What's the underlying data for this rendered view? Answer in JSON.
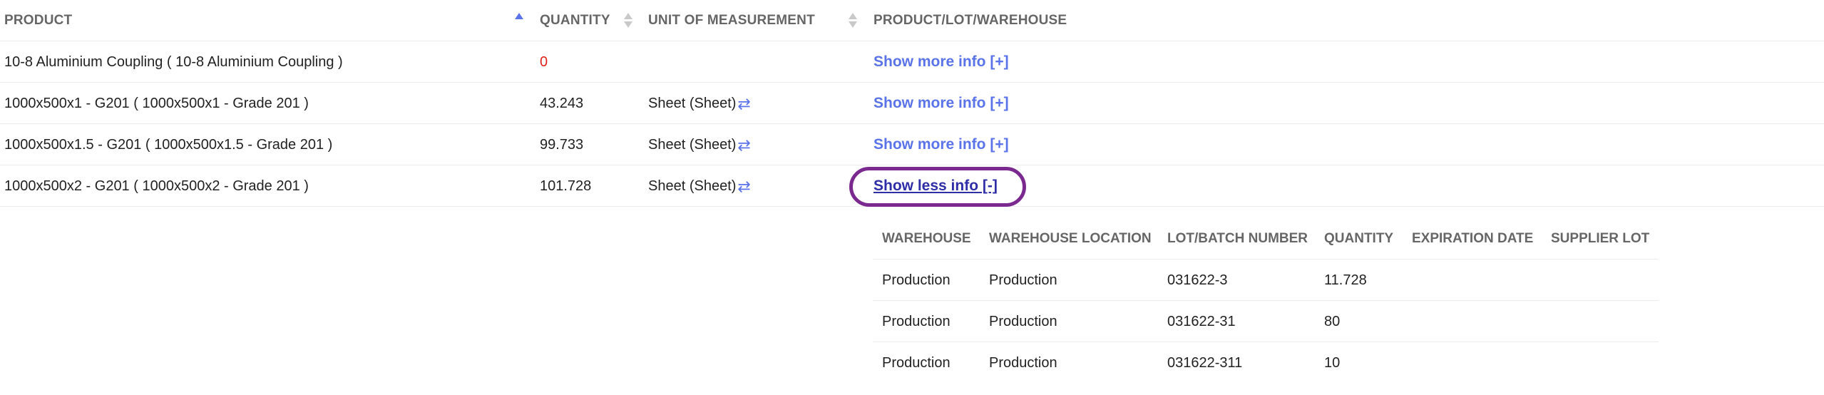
{
  "header": {
    "product": "PRODUCT",
    "quantity": "QUANTITY",
    "uom": "UNIT OF MEASUREMENT",
    "plw": "PRODUCT/LOT/WAREHOUSE"
  },
  "rows": [
    {
      "product": "10-8 Aluminium Coupling ( 10-8 Aluminium Coupling )",
      "quantity": "0",
      "uom": "",
      "info": "Show more info [+]"
    },
    {
      "product": "1000x500x1 - G201 ( 1000x500x1 - Grade 201 )",
      "quantity": "43.243",
      "uom": "Sheet (Sheet)",
      "info": "Show more info [+]"
    },
    {
      "product": "1000x500x1.5 - G201 ( 1000x500x1.5 - Grade 201 )",
      "quantity": "99.733",
      "uom": "Sheet (Sheet)",
      "info": "Show more info [+]"
    },
    {
      "product": "1000x500x2 - G201 ( 1000x500x2 - Grade 201 )",
      "quantity": "101.728",
      "uom": "Sheet (Sheet)",
      "info": "Show less info [-]"
    }
  ],
  "detail": {
    "headers": [
      "WAREHOUSE",
      "WAREHOUSE LOCATION",
      "LOT/BATCH NUMBER",
      "QUANTITY",
      "EXPIRATION DATE",
      "SUPPLIER LOT"
    ],
    "rows": [
      {
        "warehouse": "Production",
        "location": "Production",
        "lot": "031622-3",
        "quantity": "11.728",
        "expiration": "",
        "supplier_lot": ""
      },
      {
        "warehouse": "Production",
        "location": "Production",
        "lot": "031622-31",
        "quantity": "80",
        "expiration": "",
        "supplier_lot": ""
      },
      {
        "warehouse": "Production",
        "location": "Production",
        "lot": "031622-311",
        "quantity": "10",
        "expiration": "",
        "supplier_lot": ""
      }
    ]
  },
  "colors": {
    "link": "#5b73e8",
    "link_active": "#2f2ea8",
    "zero_qty": "#e0231c",
    "highlight": "#7a2a8f"
  },
  "icons": {
    "sort": "sort-icon",
    "swap": "swap-arrows-icon"
  }
}
